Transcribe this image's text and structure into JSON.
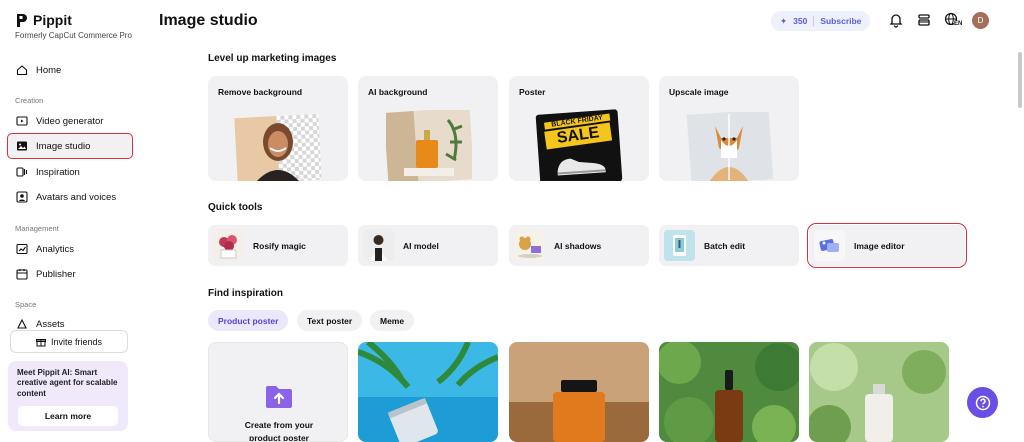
{
  "brand": {
    "name": "Pippit",
    "subtitle": "Formerly CapCut Commerce Pro"
  },
  "sidebar": {
    "home": "Home",
    "creation_label": "Creation",
    "creation": [
      "Video generator",
      "Image studio",
      "Inspiration",
      "Avatars and voices"
    ],
    "management_label": "Management",
    "management": [
      "Analytics",
      "Publisher"
    ],
    "space_label": "Space",
    "space": [
      "Assets"
    ],
    "invite": "Invite friends",
    "promo_text": "Meet Pippit AI: Smart creative agent for scalable content",
    "promo_button": "Learn more"
  },
  "header": {
    "title": "Image studio",
    "credits": "350",
    "subscribe": "Subscribe",
    "avatar_initial": "D",
    "lang_badge": "EN"
  },
  "level_up": {
    "title": "Level up marketing images",
    "cards": [
      "Remove background",
      "AI background",
      "Poster",
      "Upscale image"
    ],
    "poster_line1": "BLACK FRIDAY",
    "poster_line2": "SALE"
  },
  "quick_tools": {
    "title": "Quick tools",
    "items": [
      "Rosify magic",
      "AI model",
      "AI shadows",
      "Batch edit",
      "Image editor"
    ]
  },
  "inspiration": {
    "title": "Find inspiration",
    "chips": [
      "Product poster",
      "Text poster",
      "Meme"
    ],
    "create_text_1": "Create from your",
    "create_text_2": "product poster"
  },
  "colors": {
    "accent": "#5b5fd6",
    "help": "#6b4ee6",
    "highlight_box": "#d9303a"
  }
}
